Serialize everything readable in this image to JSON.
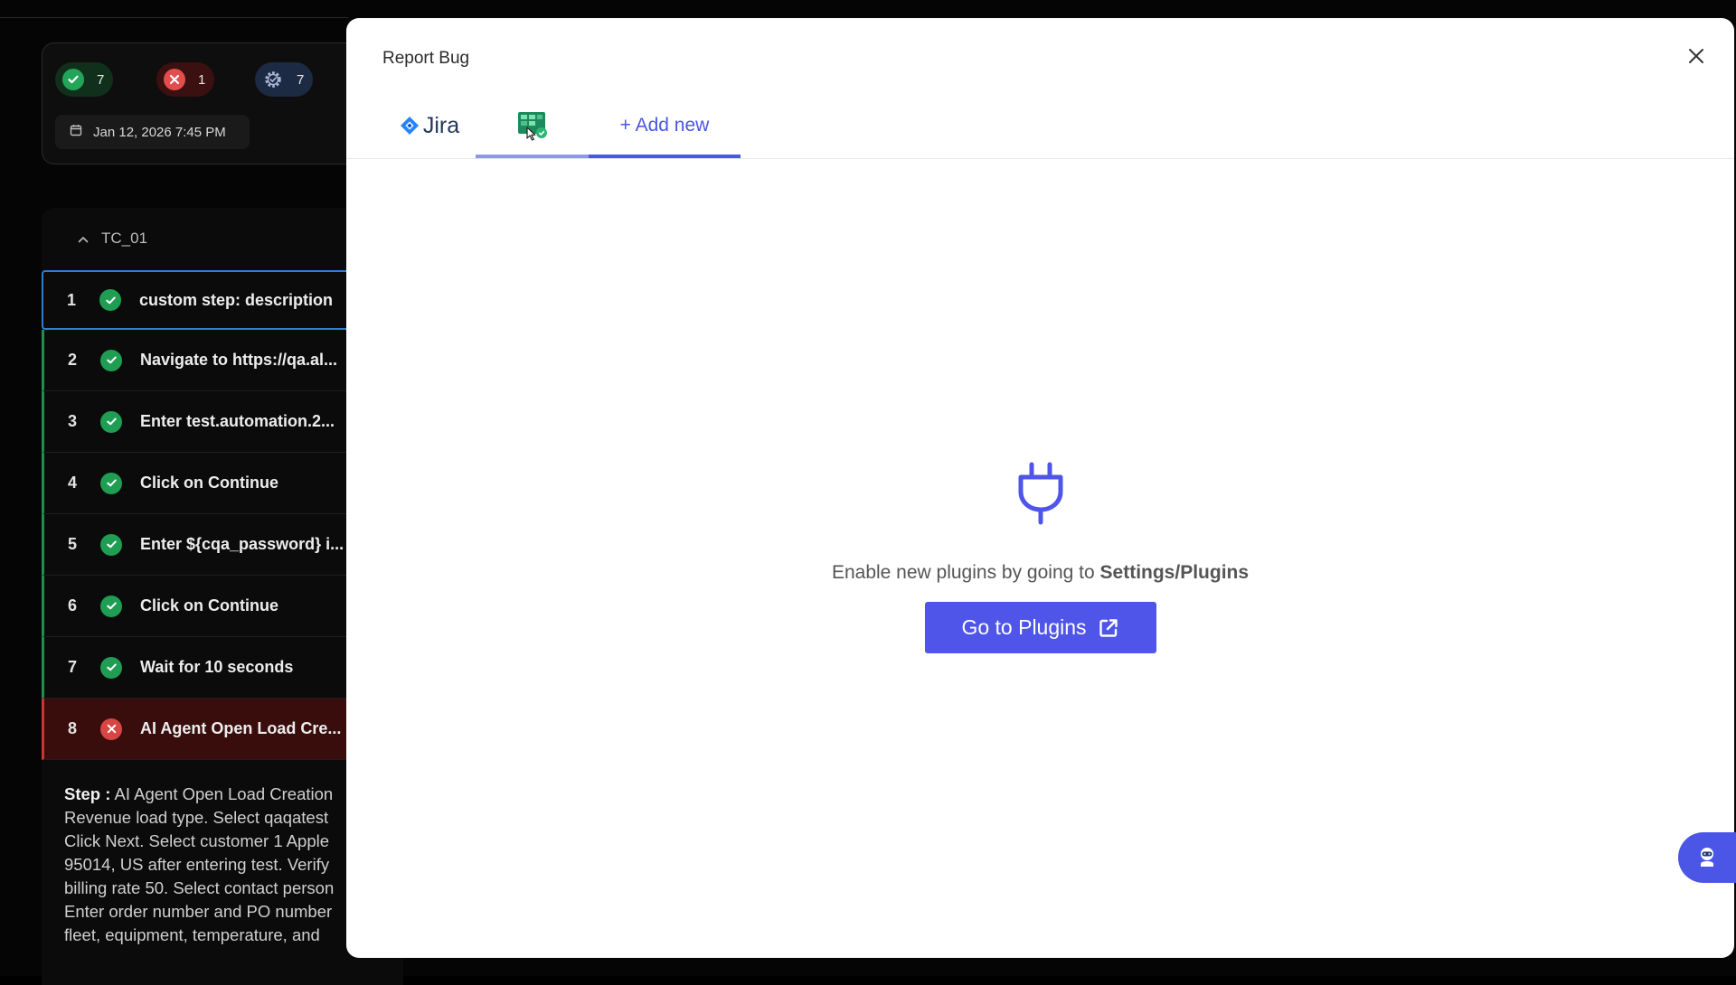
{
  "summary": {
    "passed_count": "7",
    "failed_count": "1",
    "gear_count": "7",
    "date": "Jan 12, 2026 7:45 PM"
  },
  "testcase": {
    "name": "TC_01",
    "steps": [
      {
        "num": "1",
        "status": "pass",
        "text": "custom step: description"
      },
      {
        "num": "2",
        "status": "pass",
        "text": "Navigate to https://qa.al..."
      },
      {
        "num": "3",
        "status": "pass",
        "text": "Enter test.automation.2..."
      },
      {
        "num": "4",
        "status": "pass",
        "text": "Click on Continue"
      },
      {
        "num": "5",
        "status": "pass",
        "text": "Enter ${cqa_password} i..."
      },
      {
        "num": "6",
        "status": "pass",
        "text": "Click on Continue"
      },
      {
        "num": "7",
        "status": "pass",
        "text": "Wait for 10 seconds"
      },
      {
        "num": "8",
        "status": "fail",
        "text": "AI Agent Open Load Cre..."
      }
    ],
    "detail_label": "Step :",
    "detail_lines": [
      "AI Agent Open Load Creation",
      "Revenue load type. Select qaqatest",
      "Click Next. Select customer 1 Apple",
      "95014, US after entering test. Verify",
      "billing rate 50. Select contact person",
      "Enter order number and PO number",
      "fleet, equipment, temperature, and"
    ]
  },
  "modal": {
    "title": "Report Bug",
    "tabs": {
      "jira_label": "Jira",
      "add_label": "+ Add new"
    },
    "empty_state": {
      "message_prefix": "Enable new plugins by going to",
      "message_bold": "Settings/Plugins",
      "button_label": "Go to Plugins"
    }
  },
  "colors": {
    "accent": "#4f55e8",
    "pass": "#1f9e53",
    "fail": "#d84545",
    "active_border": "#2d7fd3"
  }
}
